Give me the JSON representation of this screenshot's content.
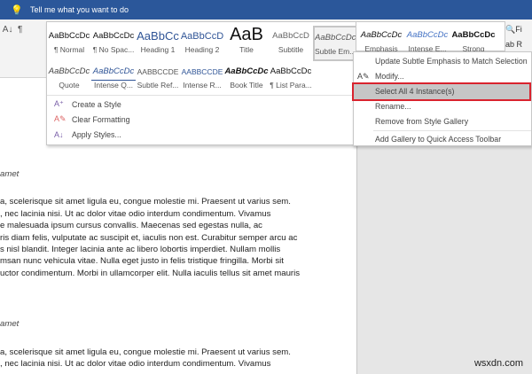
{
  "topbar": {
    "search_text": "Tell me what you want to do",
    "icon": "lightbulb-icon",
    "color": "#2b579a"
  },
  "ribbon_right": [
    "Fi",
    "R"
  ],
  "gallery": {
    "row1": [
      {
        "sample": "AaBbCcDc",
        "name": "¶ Normal"
      },
      {
        "sample": "AaBbCcDc",
        "name": "¶ No Spac..."
      },
      {
        "sample": "AaBbCc",
        "name": "Heading 1"
      },
      {
        "sample": "AaBbCcD",
        "name": "Heading 2"
      },
      {
        "sample": "AaB",
        "name": "Title"
      },
      {
        "sample": "AaBbCcD",
        "name": "Subtitle"
      },
      {
        "sample": "AaBbCcDc",
        "name": "Subtle Em..."
      }
    ],
    "row1_extra": [
      {
        "sample": "AaBbCcDc",
        "name": "Emphasis"
      },
      {
        "sample": "AaBbCcDc",
        "name": "Intense E..."
      },
      {
        "sample": "AaBbCcDc",
        "name": "Strong"
      }
    ],
    "row2": [
      {
        "sample": "AaBbCcDc",
        "name": "Quote"
      },
      {
        "sample": "AaBbCcDc",
        "name": "Intense Q..."
      },
      {
        "sample": "AABBCCDE",
        "name": "Subtle Ref..."
      },
      {
        "sample": "AABBCCDE",
        "name": "Intense R..."
      },
      {
        "sample": "AaBbCcDc",
        "name": "Book Title"
      },
      {
        "sample": "AaBbCcDc",
        "name": "¶ List Para..."
      }
    ],
    "actions": [
      {
        "label": "Create a Style",
        "icon": "create-style-icon"
      },
      {
        "label": "Clear Formatting",
        "icon": "eraser-icon"
      },
      {
        "label": "Apply Styles...",
        "icon": "apply-styles-icon"
      }
    ]
  },
  "context_menu": {
    "items": [
      "Update Subtle Emphasis to Match Selection",
      "Modify...",
      "Select All 4 Instance(s)",
      "Rename...",
      "Remove from Style Gallery",
      "Add Gallery to Quick Access Toolbar"
    ],
    "highlighted": "Select All 4 Instance(s)",
    "highlight_color": "#d9232e"
  },
  "document": {
    "heading1": "amet",
    "para1": [
      "a, scelerisque sit amet ligula eu, congue molestie mi. Praesent ut varius sem.",
      ", nec lacinia nisi. Ut ac dolor vitae odio interdum condimentum. Vivamus",
      "e malesuada ipsum cursus convallis. Maecenas sed egestas nulla, ac",
      "ris diam felis, vulputate ac suscipit et, iaculis non est. Curabitur semper arcu ac",
      "s nisl blandit. Integer lacinia ante ac libero lobortis imperdiet. Nullam mollis",
      "msan nunc vehicula vitae. Nulla eget justo in felis tristique fringilla. Morbi sit",
      "uctor condimentum. Morbi in ullamcorper elit. Nulla iaculis tellus sit amet mauris"
    ],
    "heading2": "amet",
    "para2": [
      "a, scelerisque sit amet ligula eu, congue molestie mi. Praesent ut varius sem.",
      ", nec lacinia nisi. Ut ac dolor vitae odio interdum condimentum. Vivamus"
    ]
  },
  "watermark": "wsxdn.com"
}
